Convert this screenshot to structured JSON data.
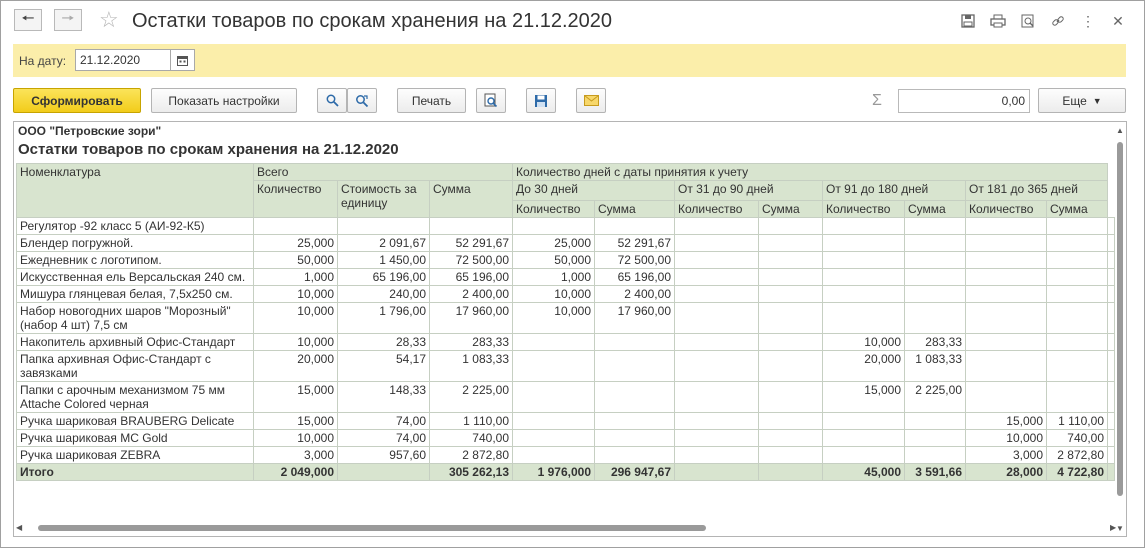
{
  "window": {
    "title": "Остатки товаров по срокам хранения на 21.12.2020",
    "back_icon": "arrow-left",
    "forward_icon": "arrow-right",
    "favorite_icon": "star"
  },
  "date_bar": {
    "label": "На дату:",
    "value": "21.12.2020"
  },
  "toolbar": {
    "generate_label": "Сформировать",
    "settings_label": "Показать настройки",
    "print_label": "Печать",
    "more_label": "Еще",
    "sum_value": "0,00"
  },
  "report": {
    "organization": "ООО \"Петровские зори\"",
    "title": "Остатки товаров по срокам хранения на 21.12.2020",
    "headers": {
      "nomenclature": "Номенклатура",
      "total": "Всего",
      "days_group": "Количество дней с даты принятия к учету",
      "quantity": "Количество",
      "unit_cost": "Стоимость за единицу",
      "sum": "Сумма",
      "p1": "До 30 дней",
      "p2": "От 31 до 90 дней",
      "p3": "От 91 до 180 дней",
      "p4": "От 181 до 365 дней"
    },
    "rows": [
      {
        "name": "Регулятор -92 класс 5 (АИ-92-К5)",
        "cells": [
          "",
          "",
          "",
          "",
          "",
          "",
          "",
          "",
          "",
          "",
          ""
        ]
      },
      {
        "name": "Блендер погружной.",
        "cells": [
          "25,000",
          "2 091,67",
          "52 291,67",
          "25,000",
          "52 291,67",
          "",
          "",
          "",
          "",
          "",
          ""
        ]
      },
      {
        "name": "Ежедневник с логотипом.",
        "cells": [
          "50,000",
          "1 450,00",
          "72 500,00",
          "50,000",
          "72 500,00",
          "",
          "",
          "",
          "",
          "",
          ""
        ]
      },
      {
        "name": "Искусственная ель Версальская 240 см.",
        "cells": [
          "1,000",
          "65 196,00",
          "65 196,00",
          "1,000",
          "65 196,00",
          "",
          "",
          "",
          "",
          "",
          ""
        ]
      },
      {
        "name": "Мишура глянцевая белая, 7,5х250 см.",
        "cells": [
          "10,000",
          "240,00",
          "2 400,00",
          "10,000",
          "2 400,00",
          "",
          "",
          "",
          "",
          "",
          ""
        ]
      },
      {
        "name": "Набор новогодних шаров \"Морозный\" (набор 4 шт) 7,5 см",
        "cells": [
          "10,000",
          "1 796,00",
          "17 960,00",
          "10,000",
          "17 960,00",
          "",
          "",
          "",
          "",
          "",
          ""
        ]
      },
      {
        "name": "Накопитель архивный Офис-Стандарт",
        "cells": [
          "10,000",
          "28,33",
          "283,33",
          "",
          "",
          "",
          "",
          "10,000",
          "283,33",
          "",
          ""
        ]
      },
      {
        "name": "Папка архивная Офис-Стандарт с завязками",
        "cells": [
          "20,000",
          "54,17",
          "1 083,33",
          "",
          "",
          "",
          "",
          "20,000",
          "1 083,33",
          "",
          ""
        ]
      },
      {
        "name": "Папки с арочным механизмом 75 мм Attache Colored черная",
        "cells": [
          "15,000",
          "148,33",
          "2 225,00",
          "",
          "",
          "",
          "",
          "15,000",
          "2 225,00",
          "",
          ""
        ]
      },
      {
        "name": "Ручка шариковая BRAUBERG Delicate",
        "cells": [
          "15,000",
          "74,00",
          "1 110,00",
          "",
          "",
          "",
          "",
          "",
          "",
          "15,000",
          "1 110,00"
        ]
      },
      {
        "name": "Ручка шариковая MC Gold",
        "cells": [
          "10,000",
          "74,00",
          "740,00",
          "",
          "",
          "",
          "",
          "",
          "",
          "10,000",
          "740,00"
        ]
      },
      {
        "name": "Ручка шариковая ZEBRA",
        "cells": [
          "3,000",
          "957,60",
          "2 872,80",
          "",
          "",
          "",
          "",
          "",
          "",
          "3,000",
          "2 872,80"
        ]
      }
    ],
    "total": {
      "label": "Итого",
      "cells": [
        "2 049,000",
        "",
        "305 262,13",
        "1 976,000",
        "296 947,67",
        "",
        "",
        "45,000",
        "3 591,66",
        "28,000",
        "4 722,80"
      ]
    }
  }
}
